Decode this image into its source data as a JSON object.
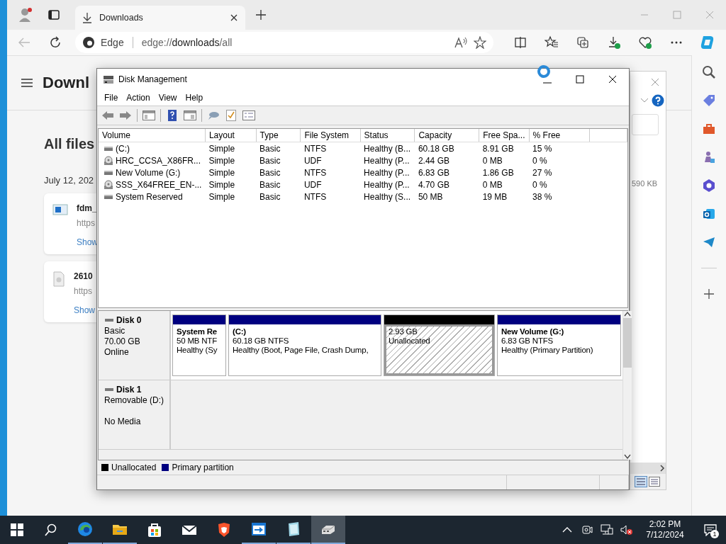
{
  "browser": {
    "tab": {
      "title": "Downloads"
    },
    "address": {
      "site": "Edge",
      "url": "edge://**downloads**/all"
    }
  },
  "page": {
    "title": "Downl",
    "section": "All files",
    "date": "July 12, 202",
    "items": [
      {
        "kind": "installer",
        "name": "fdm_",
        "url": "https",
        "link": "Show"
      },
      {
        "kind": "file",
        "name": "2610",
        "url": "https",
        "link": "Show"
      }
    ]
  },
  "dialog": {
    "size": "590 KB"
  },
  "disk_management": {
    "title": "Disk Management",
    "menu": [
      "File",
      "Action",
      "View",
      "Help"
    ],
    "columns": [
      "Volume",
      "Layout",
      "Type",
      "File System",
      "Status",
      "Capacity",
      "Free Spa...",
      "% Free"
    ],
    "rows": [
      {
        "kind": "disk",
        "cells": [
          " (C:)",
          "Simple",
          "Basic",
          "NTFS",
          "Healthy (B...",
          "60.18 GB",
          "8.91 GB",
          "15 %"
        ]
      },
      {
        "kind": "optical",
        "cells": [
          "HRC_CCSA_X86FR...",
          "Simple",
          "Basic",
          "UDF",
          "Healthy (P...",
          "2.44 GB",
          "0 MB",
          "0 %"
        ]
      },
      {
        "kind": "disk",
        "cells": [
          "New Volume (G:)",
          "Simple",
          "Basic",
          "NTFS",
          "Healthy (P...",
          "6.83 GB",
          "1.86 GB",
          "27 %"
        ]
      },
      {
        "kind": "optical",
        "cells": [
          "SSS_X64FREE_EN-...",
          "Simple",
          "Basic",
          "UDF",
          "Healthy (P...",
          "4.70 GB",
          "0 MB",
          "0 %"
        ]
      },
      {
        "kind": "disk",
        "cells": [
          "System Reserved",
          "Simple",
          "Basic",
          "NTFS",
          "Healthy (S...",
          "50 MB",
          "19 MB",
          "38 %"
        ]
      }
    ],
    "disks": [
      {
        "name": "Disk 0",
        "type": "Basic",
        "size": "70.00 GB",
        "status": "Online",
        "partitions": [
          {
            "kind": "primary",
            "name": "System Re",
            "size": "50 MB NTF",
            "status": "Healthy (Sy",
            "selected": false
          },
          {
            "kind": "primary",
            "name": "(C:)",
            "size": "60.18 GB NTFS",
            "status": "Healthy (Boot, Page File, Crash Dump,",
            "selected": false
          },
          {
            "kind": "unallocated",
            "size": "2.93 GB",
            "status": "Unallocated",
            "selected": true
          },
          {
            "kind": "primary",
            "name": "New Volume  (G:)",
            "size": "6.83 GB NTFS",
            "status": "Healthy (Primary Partition)",
            "selected": false
          }
        ]
      },
      {
        "name": "Disk 1",
        "type": "Removable (D:)",
        "status": "No Media"
      }
    ],
    "legend": [
      {
        "kind": "unallocated",
        "label": "Unallocated",
        "color": "#000000"
      },
      {
        "kind": "primary",
        "label": "Primary partition",
        "color": "#000080"
      }
    ]
  },
  "taskbar": {
    "apps": [
      {
        "kind": "browser",
        "running": true,
        "selected": false
      },
      {
        "kind": "folder",
        "running": true,
        "selected": false
      },
      {
        "kind": "store",
        "running": false,
        "selected": false
      },
      {
        "kind": "mail",
        "running": false,
        "selected": false
      },
      {
        "kind": "shield",
        "running": false,
        "selected": false
      },
      {
        "kind": "remote",
        "running": true,
        "selected": false
      },
      {
        "kind": "notepad",
        "running": true,
        "selected": false
      },
      {
        "kind": "drive",
        "running": true,
        "selected": true
      }
    ],
    "time": "2:02 PM",
    "date": "7/12/2024",
    "notifications": "1"
  }
}
